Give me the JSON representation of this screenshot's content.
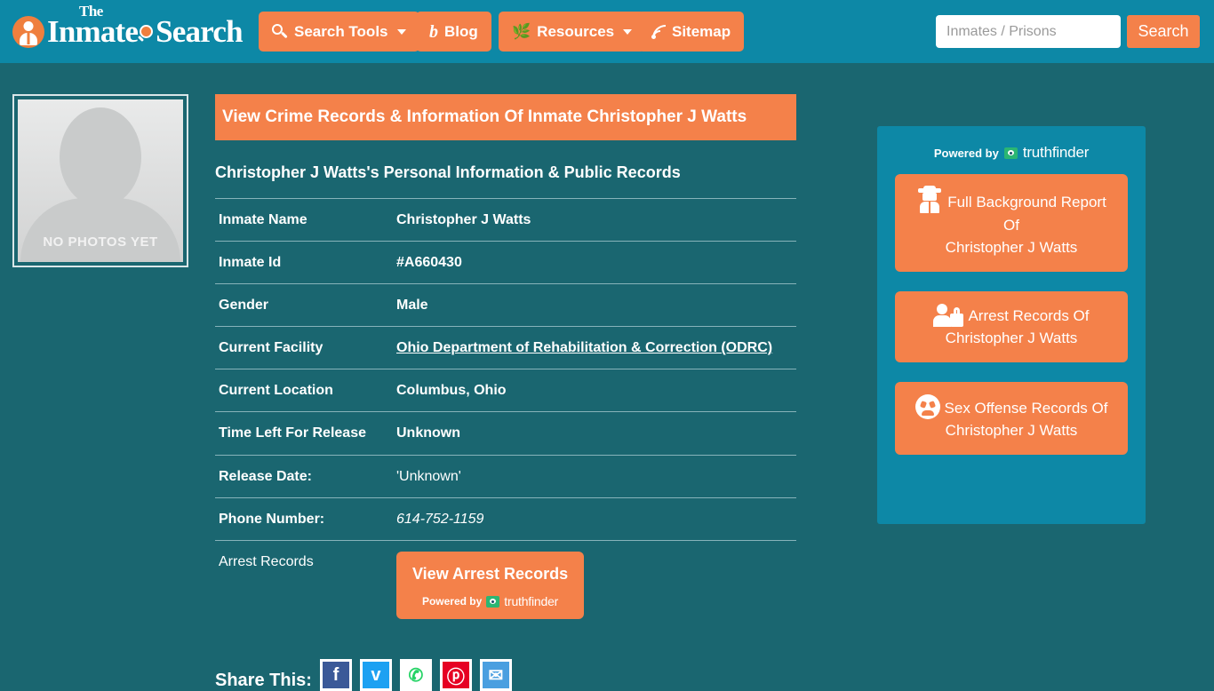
{
  "colors": {
    "header_teal": "#0d88a6",
    "body_teal": "#1a6670",
    "accent_orange": "#f4814a",
    "text_white": "#ffffff",
    "truthfinder_green": "#2bb673"
  },
  "header": {
    "logo": {
      "the": "The",
      "main_pre": "Inmate",
      "main_post": "Search",
      "badge_icon": "person-badge-icon",
      "magnifier_icon": "magnifier-icon"
    },
    "nav": [
      {
        "label": "Search Tools",
        "icon": "magnifier-icon",
        "has_caret": true
      },
      {
        "label": "Blog",
        "icon": "blog-b-icon",
        "has_caret": false
      },
      {
        "label": "Resources",
        "icon": "leaf-icon",
        "has_caret": true
      },
      {
        "label": "Sitemap",
        "icon": "rss-icon",
        "has_caret": false
      }
    ],
    "search": {
      "placeholder": "Inmates / Prisons",
      "value": "",
      "button_label": "Search"
    }
  },
  "photo": {
    "caption": "NO PHOTOS YET",
    "alt": "inmate-photo-placeholder"
  },
  "main": {
    "page_title": "View Crime Records & Information Of Inmate Christopher J Watts",
    "subtitle": "Christopher J Watts's Personal Information & Public Records",
    "table": {
      "rows": [
        {
          "key": "Inmate Name",
          "value": "Christopher J Watts",
          "style": "bold"
        },
        {
          "key": "Inmate Id",
          "value": "#A660430",
          "style": "bold"
        },
        {
          "key": "Gender",
          "value": "Male",
          "style": "bold"
        },
        {
          "key": "Current Facility",
          "value": "Ohio Department of Rehabilitation & Correction (ODRC)",
          "style": "link"
        },
        {
          "key": "Current Location",
          "value": "Columbus, Ohio",
          "style": "bold"
        },
        {
          "key": "Time Left For Release",
          "value": "Unknown",
          "style": "bold"
        },
        {
          "key": "Release Date:",
          "value": "'Unknown'",
          "style": "plain"
        },
        {
          "key": "Phone Number:",
          "value": "614-752-1159",
          "style": "italic"
        },
        {
          "key": "Arrest Records",
          "value": "",
          "style": "button"
        }
      ]
    },
    "arrest_button": {
      "label": "View Arrest Records",
      "powered_by": "Powered by",
      "brand": "truthfinder"
    }
  },
  "share": {
    "label": "Share This:",
    "icons": [
      {
        "name": "facebook-share-icon",
        "glyph": "f"
      },
      {
        "name": "twitter-share-icon",
        "glyph": "ᴠ"
      },
      {
        "name": "whatsapp-share-icon",
        "glyph": "✆"
      },
      {
        "name": "pinterest-share-icon",
        "glyph": "ⓟ"
      },
      {
        "name": "email-share-icon",
        "glyph": "✉"
      }
    ]
  },
  "sidebar": {
    "powered_by": "Powered by",
    "brand": "truthfinder",
    "cards": [
      {
        "icon": "detective-icon",
        "line1": "Full Background Report",
        "line2": "Of",
        "line3": "Christopher J Watts"
      },
      {
        "icon": "person-lock-icon",
        "line1": "Arrest Records Of",
        "line2": "Christopher J Watts",
        "line3": ""
      },
      {
        "icon": "angry-face-icon",
        "line1": "Sex Offense Records Of",
        "line2": "Christopher J Watts",
        "line3": ""
      }
    ]
  }
}
